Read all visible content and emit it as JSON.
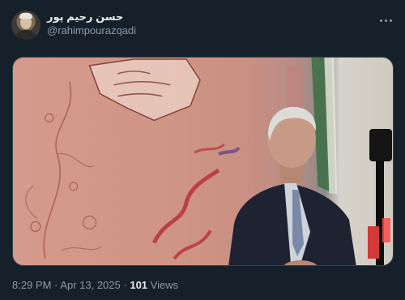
{
  "tweet": {
    "author": {
      "display_name": "حسن رحیم پور",
      "handle": "@rahimpourazqadi"
    },
    "more_icon": "more-horizontal-icon",
    "media": {
      "type": "video-frame",
      "colors": {
        "backdrop": "#d49a8c",
        "suit": "#1f2230",
        "banner_red": "#b8313a"
      }
    },
    "timestamp": {
      "time": "8:29 PM",
      "separator": "·",
      "date": "Apr 13, 2025",
      "views_count": "101",
      "views_label": "Views"
    }
  },
  "theme": {
    "background": "#15202b",
    "text_primary": "#e7e9ea",
    "text_secondary": "#8b98a5",
    "border": "#38444d"
  }
}
